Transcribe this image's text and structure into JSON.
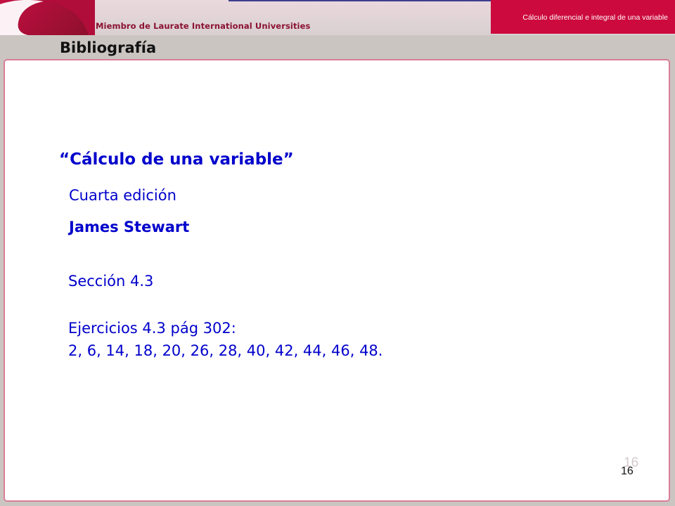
{
  "header": {
    "affiliation": "Miembro de Laurate International Universities",
    "course_title": "Cálculo diferencial e integral de una variable",
    "colors": {
      "brand": "#cc0a3d",
      "logo_dark": "#8a0f2c"
    }
  },
  "slide": {
    "heading": "Bibliografía",
    "book_title": "“Cálculo de una variable”",
    "edition": "Cuarta edición",
    "author": "James Stewart",
    "section": "Sección 4.3",
    "exercises_label": "Ejercicios 4.3 pág 302:",
    "exercises_list": "2, 6, 14, 18, 20, 26, 28, 40, 42, 44, 46, 48.",
    "text_color": "#0000cc"
  },
  "footer": {
    "ghost_page_number": "16",
    "page_number": "16"
  }
}
